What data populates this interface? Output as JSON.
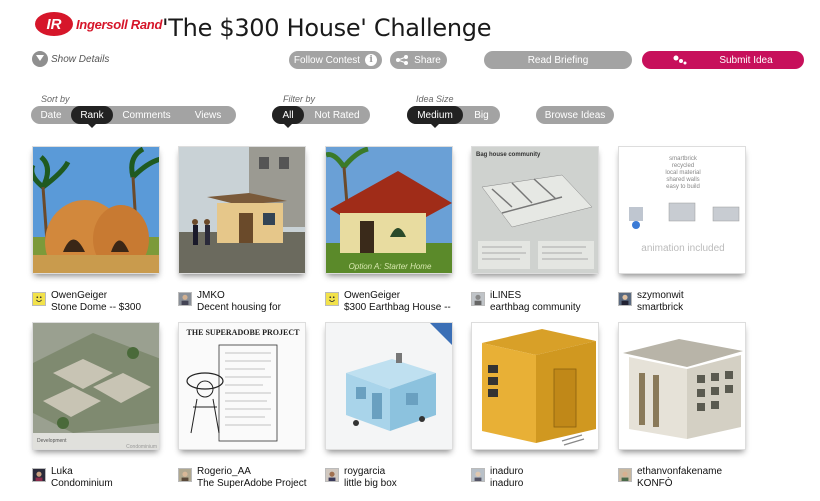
{
  "header": {
    "brand": "Ingersoll Rand",
    "title": "'The $300 House' Challenge"
  },
  "actions": {
    "show_details": "Show Details",
    "follow": "Follow Contest",
    "share": "Share",
    "briefing": "Read Briefing",
    "submit": "Submit Idea"
  },
  "sort": {
    "label": "Sort by",
    "options": [
      "Date",
      "Rank",
      "Comments",
      "Views"
    ],
    "active": "Rank"
  },
  "filter": {
    "label": "Filter by",
    "options": [
      "All",
      "Not Rated"
    ],
    "active": "All"
  },
  "size": {
    "label": "Idea Size",
    "options": [
      "Medium",
      "Big"
    ],
    "active": "Medium"
  },
  "browse": "Browse Ideas",
  "ideas": [
    {
      "author": "OwenGeiger",
      "title": "Stone Dome -- $300",
      "thumb": "dome",
      "avatar": "smiley"
    },
    {
      "author": "JMKO",
      "title": "Decent housing for",
      "thumb": "photo-house",
      "avatar": "photo"
    },
    {
      "author": "OwenGeiger",
      "title": "$300 Earthbag House --",
      "thumb": "render-house",
      "avatar": "smiley",
      "thumb_caption": "Option A: Starter Home"
    },
    {
      "author": "iLINES",
      "title": "earthbag community",
      "thumb": "plan",
      "avatar": "photo",
      "thumb_caption": "Bag house community"
    },
    {
      "author": "szymonwit",
      "title": "smartbrick",
      "thumb": "smartbrick",
      "avatar": "photo",
      "thumb_lines": [
        "smartbrick",
        "recycled",
        "local material",
        "shared walls",
        "easy to build"
      ],
      "thumb_caption": "animation included"
    },
    {
      "author": "Luka",
      "title": "Condominium",
      "thumb": "condo",
      "avatar": "photo",
      "thumb_caption": "Development",
      "thumb_caption2": "Condominium"
    },
    {
      "author": "Rogerio_AA",
      "title": "The SuperAdobe Project",
      "thumb": "superadobe",
      "avatar": "photo",
      "thumb_caption": "THE SUPERADOBE PROJECT"
    },
    {
      "author": "roygarcia",
      "title": "little big box",
      "thumb": "box",
      "avatar": "photo"
    },
    {
      "author": "inaduro",
      "title": "inaduro",
      "thumb": "yellow",
      "avatar": "photo"
    },
    {
      "author": "ethanvonfakename",
      "title": "KONFÒ",
      "thumb": "konfo",
      "avatar": "photo"
    }
  ],
  "colors": {
    "accent": "#c7105b",
    "brand": "#d6162a",
    "pill": "#a3a3a3",
    "active": "#222222"
  }
}
